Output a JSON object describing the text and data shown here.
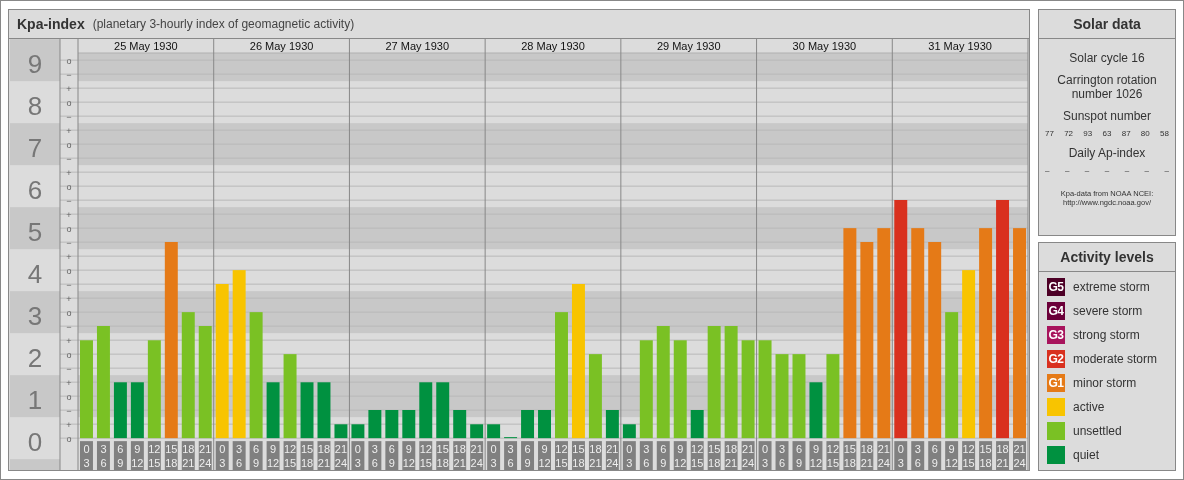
{
  "kpa_panel": {
    "title": "Kpa-index",
    "subtitle": "(planetary 3-hourly index of geomagnetic activity)",
    "days": [
      "25 May 1930",
      "26 May 1930",
      "27 May 1930",
      "28 May 1930",
      "29 May 1930",
      "30 May 1930",
      "31 May 1930"
    ],
    "minor_ticks": [
      "o",
      "−",
      "+",
      "o",
      "−",
      "+",
      "o",
      "−",
      "+",
      "o",
      "−",
      "+",
      "o",
      "−",
      "+",
      "o",
      "−",
      "+",
      "o",
      "−",
      "+",
      "o",
      "−",
      "+",
      "o",
      "−",
      "+",
      "o"
    ],
    "chart_data": {
      "type": "bar",
      "grid": true,
      "ylim": [
        0,
        9.17
      ],
      "yticks": [
        {
          "value": 0,
          "label": "0"
        },
        {
          "value": 1,
          "label": "1"
        },
        {
          "value": 2,
          "label": "2"
        },
        {
          "value": 3,
          "label": "3"
        },
        {
          "value": 4,
          "label": "4"
        },
        {
          "value": 5,
          "label": "5"
        },
        {
          "value": 6,
          "label": "6"
        },
        {
          "value": 7,
          "label": "7"
        },
        {
          "value": 8,
          "label": "8"
        },
        {
          "value": 9,
          "label": "9"
        }
      ],
      "categories": [
        "0 3",
        "3 6",
        "6 9",
        "9 12",
        "12 15",
        "15 18",
        "18 21",
        "21 24",
        "0 3",
        "3 6",
        "6 9",
        "9 12",
        "12 15",
        "15 18",
        "18 21",
        "21 24",
        "0 3",
        "3 6",
        "6 9",
        "9 12",
        "12 15",
        "15 18",
        "18 21",
        "21 24",
        "0 3",
        "3 6",
        "6 9",
        "9 12",
        "12 15",
        "15 18",
        "18 21",
        "21 24",
        "0 3",
        "3 6",
        "6 9",
        "9 12",
        "12 15",
        "15 18",
        "18 21",
        "21 24",
        "0 3",
        "3 6",
        "6 9",
        "9 12",
        "12 15",
        "15 18",
        "18 21",
        "21 24",
        "0 3",
        "3 6",
        "6 9",
        "9 12",
        "12 15",
        "15 18",
        "18 21",
        "21 24"
      ],
      "series": [
        {
          "color": "#009140",
          "values": [
            null,
            null,
            1.33,
            1.33,
            null,
            null,
            null,
            null,
            null,
            null,
            null,
            1.33,
            null,
            1.33,
            1.33,
            0.33,
            0.33,
            0.67,
            0.67,
            0.67,
            1.33,
            1.33,
            0.67,
            0.33,
            0.33,
            0,
            0.67,
            0.67,
            null,
            null,
            null,
            0.67,
            0.33,
            null,
            null,
            null,
            0.67,
            null,
            null,
            null,
            null,
            null,
            null,
            1.33,
            null,
            null,
            null,
            null,
            null,
            null,
            null,
            null,
            null,
            null,
            null,
            null
          ]
        },
        {
          "color": "#7ac124",
          "values": [
            2.33,
            2.67,
            null,
            null,
            2.33,
            null,
            3,
            2.67,
            null,
            null,
            3,
            null,
            2,
            null,
            null,
            null,
            null,
            null,
            null,
            null,
            null,
            null,
            null,
            null,
            null,
            null,
            null,
            null,
            3,
            null,
            2,
            null,
            null,
            2.33,
            2.67,
            2.33,
            null,
            2.67,
            2.67,
            2.33,
            2.33,
            2,
            2,
            null,
            2,
            null,
            null,
            null,
            null,
            null,
            null,
            3,
            null,
            null,
            null,
            null
          ]
        },
        {
          "color": "#f8c400",
          "values": [
            null,
            null,
            null,
            null,
            null,
            null,
            null,
            null,
            3.67,
            4,
            null,
            null,
            null,
            null,
            null,
            null,
            null,
            null,
            null,
            null,
            null,
            null,
            null,
            null,
            null,
            null,
            null,
            null,
            null,
            3.67,
            null,
            null,
            null,
            null,
            null,
            null,
            null,
            null,
            null,
            null,
            null,
            null,
            null,
            null,
            null,
            null,
            null,
            null,
            null,
            null,
            null,
            null,
            4,
            null,
            null,
            null
          ]
        },
        {
          "color": "#e57a17",
          "values": [
            null,
            null,
            null,
            null,
            null,
            4.67,
            null,
            null,
            null,
            null,
            null,
            null,
            null,
            null,
            null,
            null,
            null,
            null,
            null,
            null,
            null,
            null,
            null,
            null,
            null,
            null,
            null,
            null,
            null,
            null,
            null,
            null,
            null,
            null,
            null,
            null,
            null,
            null,
            null,
            null,
            null,
            null,
            null,
            null,
            null,
            5,
            4.67,
            5,
            null,
            5,
            4.67,
            null,
            null,
            5,
            null,
            5
          ]
        },
        {
          "color": "#d9301e",
          "values": [
            null,
            null,
            null,
            null,
            null,
            null,
            null,
            null,
            null,
            null,
            null,
            null,
            null,
            null,
            null,
            null,
            null,
            null,
            null,
            null,
            null,
            null,
            null,
            null,
            null,
            null,
            null,
            null,
            null,
            null,
            null,
            null,
            null,
            null,
            null,
            null,
            null,
            null,
            null,
            null,
            null,
            null,
            null,
            null,
            null,
            null,
            null,
            null,
            5.67,
            null,
            null,
            null,
            null,
            null,
            5.67,
            null
          ]
        }
      ]
    }
  },
  "solar_data": {
    "title": "Solar data",
    "solar_cycle": "Solar cycle 16",
    "carrington_rotation": "Carrington rotation number 1026",
    "sunspot_heading": "Sunspot number",
    "sunspot_numbers": [
      "77",
      "72",
      "93",
      "63",
      "87",
      "80",
      "58"
    ],
    "ap_heading": "Daily Ap-index",
    "ap_values": [
      "–",
      "–",
      "–",
      "–",
      "–",
      "–",
      "–"
    ],
    "source": "Kpa-data from NOAA NCEI:",
    "source_url": "http://www.ngdc.noaa.gov/"
  },
  "activity_levels": {
    "title": "Activity levels",
    "items": [
      {
        "badge": "G5",
        "label": "extreme storm",
        "color": "#4d0026"
      },
      {
        "badge": "G4",
        "label": "severe storm",
        "color": "#6b0039"
      },
      {
        "badge": "G3",
        "label": "strong storm",
        "color": "#a8145c"
      },
      {
        "badge": "G2",
        "label": "moderate storm",
        "color": "#d9301e"
      },
      {
        "badge": "G1",
        "label": "minor storm",
        "color": "#e57a17"
      },
      {
        "label": "active",
        "color": "#f8c400"
      },
      {
        "label": "unsettled",
        "color": "#7ac124"
      },
      {
        "label": "quiet",
        "color": "#009140"
      }
    ]
  }
}
